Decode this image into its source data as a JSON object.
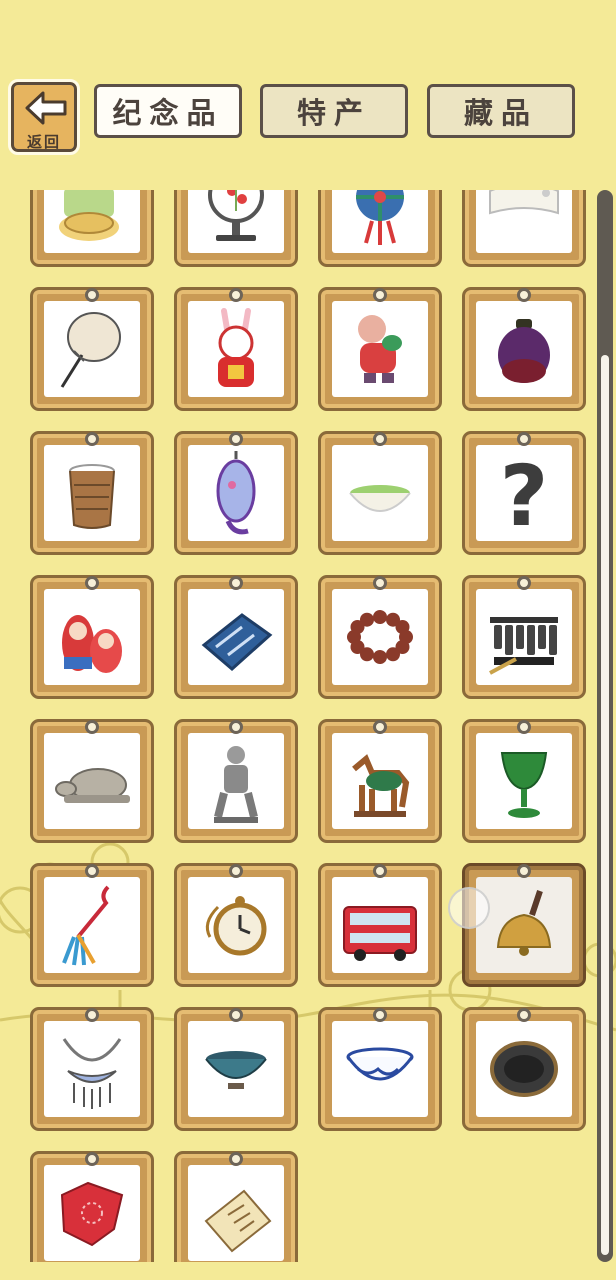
{
  "header": {
    "back_label": "返回",
    "tabs": [
      {
        "label": "纪念品",
        "active": true
      },
      {
        "label": "特产",
        "active": false
      },
      {
        "label": "藏品",
        "active": false
      }
    ]
  },
  "colors": {
    "background": "#f4ea97",
    "card_wood": "#c99a55",
    "back_button": "#e6b45f",
    "tab_border": "#5b5048"
  },
  "items": [
    {
      "icon": "mooncake-icon"
    },
    {
      "icon": "embroidery-screen-icon"
    },
    {
      "icon": "hydrangea-ball-icon"
    },
    {
      "icon": "folded-cloth-icon"
    },
    {
      "icon": "palm-fan-icon"
    },
    {
      "icon": "rabbit-god-figure-icon"
    },
    {
      "icon": "clay-doll-figure-icon"
    },
    {
      "icon": "porcelain-jar-icon"
    },
    {
      "icon": "bamboo-cup-icon"
    },
    {
      "icon": "cloisonne-vase-icon"
    },
    {
      "icon": "matcha-bowl-icon"
    },
    {
      "icon": "question-mark-icon"
    },
    {
      "icon": "matryoshka-dolls-icon"
    },
    {
      "icon": "blue-cloth-icon"
    },
    {
      "icon": "prayer-beads-icon"
    },
    {
      "icon": "chime-bells-icon"
    },
    {
      "icon": "stone-turtle-icon"
    },
    {
      "icon": "terracotta-warrior-icon"
    },
    {
      "icon": "tang-horse-icon"
    },
    {
      "icon": "jade-cup-icon"
    },
    {
      "icon": "tassel-knot-icon"
    },
    {
      "icon": "pocket-watch-icon"
    },
    {
      "icon": "double-decker-bus-icon"
    },
    {
      "icon": "bronze-bell-icon",
      "selected": true
    },
    {
      "icon": "silver-necklace-icon"
    },
    {
      "icon": "tea-bowl-icon"
    },
    {
      "icon": "blue-white-bowl-icon"
    },
    {
      "icon": "ink-stone-icon"
    },
    {
      "icon": "red-handkerchief-icon"
    },
    {
      "icon": "letter-document-icon"
    }
  ]
}
